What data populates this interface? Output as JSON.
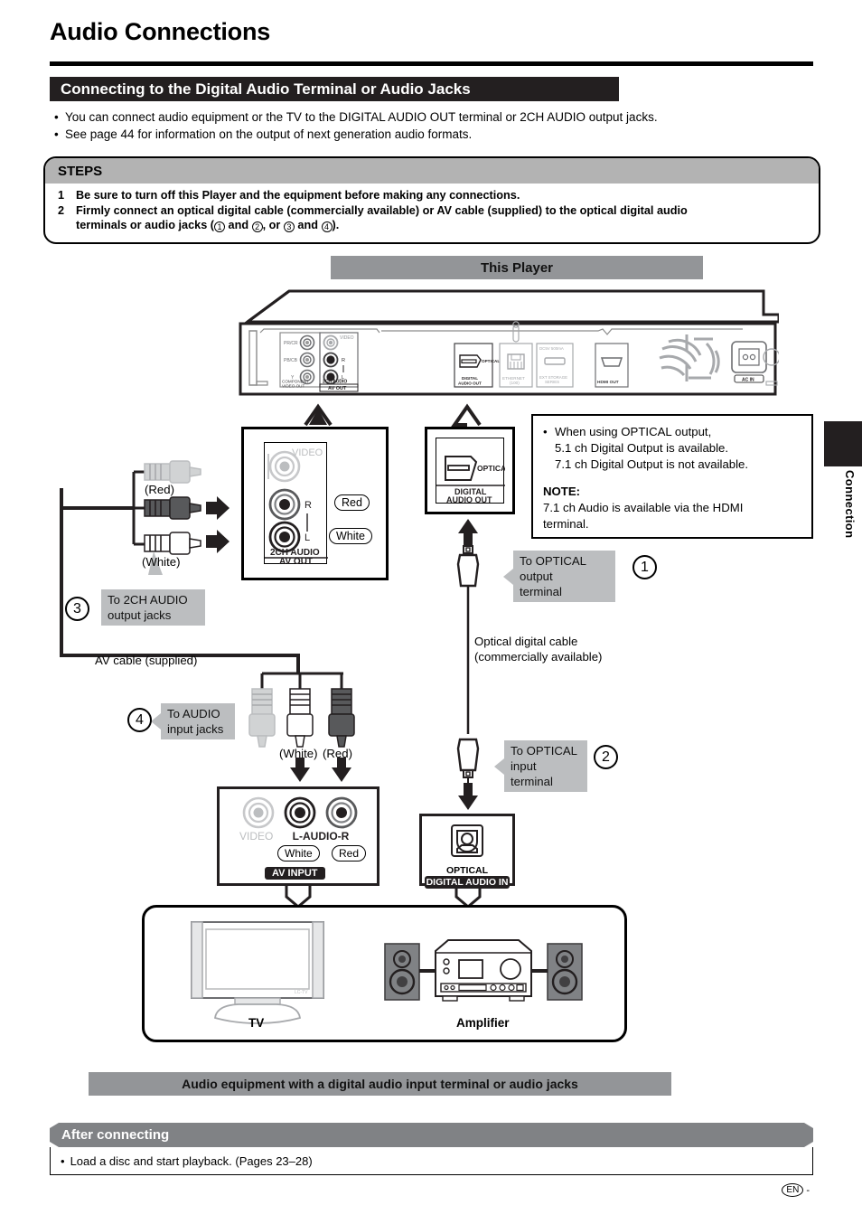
{
  "header": {
    "title": "Audio Connections",
    "section_bar": "Connecting to the Digital Audio Terminal or Audio Jacks",
    "bullets": [
      "You can connect audio equipment or the TV to the DIGITAL AUDIO OUT terminal or 2CH AUDIO output jacks.",
      "See page 44 for information on the output of next generation audio formats."
    ]
  },
  "steps": {
    "heading": "STEPS",
    "items": [
      {
        "num": "1",
        "text": "Be sure to turn off this Player and the equipment before making any connections."
      },
      {
        "num": "2",
        "text_a": "Firmly connect an optical digital cable (commercially available) or AV cable (supplied) to the optical digital audio",
        "text_b_pre": "terminals or audio jacks (",
        "c1": "1",
        "mid1": " and ",
        "c2": "2",
        "mid2": ", or ",
        "c3": "3",
        "mid3": " and ",
        "c4": "4",
        "text_b_post": ")."
      }
    ]
  },
  "player": {
    "banner": "This Player",
    "rear_labels": {
      "component_video_out": "COMPONENT VIDEO OUT",
      "pr_cr": "PR/CR",
      "pb_cb": "PB/CB",
      "y": "Y",
      "video": "VIDEO",
      "r": "R",
      "l": "L",
      "two_ch_audio": "2CH AUDIO",
      "av_out": "AV OUT",
      "optical": "OPTICAL",
      "digital_audio_out": "DIGITAL AUDIO OUT",
      "ethernet": "ETHERNET",
      "conv_5v_500ma": "DC5V 500mA",
      "usb_storage": "EXT STORAGE SERIES",
      "hdmi_out": "HDMI OUT",
      "ac_in": "AC IN"
    }
  },
  "callout_avout": {
    "video": "VIDEO",
    "r": "R",
    "l": "L",
    "two_ch_audio": "2CH AUDIO",
    "av_out": "AV OUT",
    "pill_red": "Red",
    "pill_white": "White"
  },
  "callout_optical": {
    "optical": "OPTICAL",
    "digital": "DIGITAL",
    "audio_out": "AUDIO OUT"
  },
  "note": {
    "bullet_l1": "When using OPTICAL output,",
    "bullet_l2": "5.1 ch Digital Output is available.",
    "bullet_l3": "7.1 ch Digital Output is not available.",
    "title": "NOTE:",
    "body_l1": "7.1 ch Audio is available via the HDMI",
    "body_l2": "terminal."
  },
  "cables": {
    "red_label_top": "(Red)",
    "white_label_top": "(White)",
    "tag3_l1": "To 2CH AUDIO",
    "tag3_l2": "output jacks",
    "num3": "3",
    "av_cable_supplied": "AV cable (supplied)",
    "tag4_l1": "To AUDIO",
    "tag4_l2": "input jacks",
    "num4": "4",
    "white_label_bottom": "(White)",
    "red_label_bottom": "(Red)",
    "tag1_l1": "To OPTICAL output",
    "tag1_l2": "terminal",
    "num1": "1",
    "optical_cable_l1": "Optical digital cable",
    "optical_cable_l2": "(commercially available)",
    "tag2_l1": "To OPTICAL",
    "tag2_l2": "input terminal",
    "num2": "2"
  },
  "av_input": {
    "video": "VIDEO",
    "l_audio_r": "L-AUDIO-R",
    "pill_white": "White",
    "pill_red": "Red",
    "badge": "AV INPUT"
  },
  "digital_audio_in": {
    "optical": "OPTICAL",
    "badge": "DIGITAL AUDIO IN"
  },
  "equipment": {
    "tv_label": "TV",
    "amp_label": "Amplifier"
  },
  "footer": {
    "banner": "Audio equipment with a digital audio input terminal or audio jacks",
    "after_heading": "After connecting",
    "after_bullet": "Load a disc and start playback. (Pages 23–28)",
    "side_tab": "Connection",
    "en_mark": "EN",
    "en_dash": "-"
  },
  "colors": {
    "black": "#231f20",
    "gray_banner": "#939598",
    "gray_tag": "#bcbec0",
    "gray_steps": "#b3b3b3",
    "gray_after": "#808285"
  }
}
